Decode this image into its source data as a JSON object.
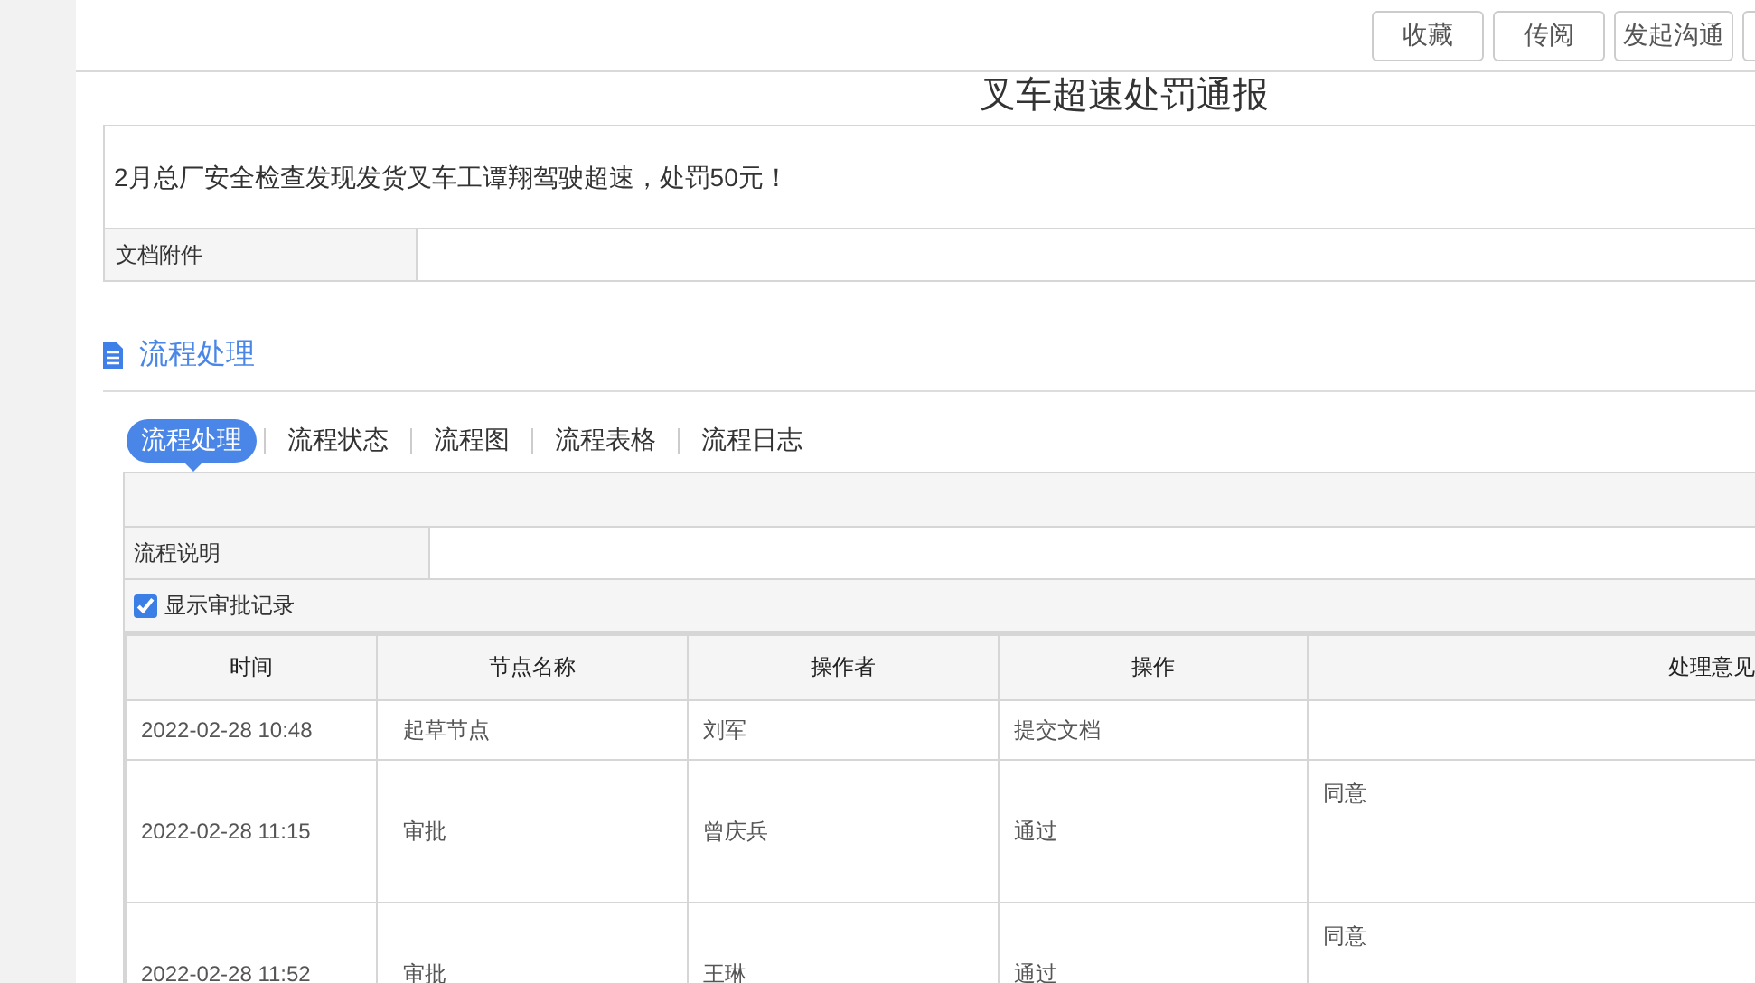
{
  "toolbar": {
    "buttons": [
      "收藏",
      "传阅",
      "发起沟通"
    ]
  },
  "document": {
    "title": "叉车超速处罚通报",
    "body": "2月总厂安全检查发现发货叉车工谭翔驾驶超速，处罚50元！",
    "attachment_label": "文档附件"
  },
  "section": {
    "title": "流程处理"
  },
  "tabs": [
    {
      "label": "流程处理",
      "selected": true
    },
    {
      "label": "流程状态",
      "selected": false
    },
    {
      "label": "流程图",
      "selected": false
    },
    {
      "label": "流程表格",
      "selected": false
    },
    {
      "label": "流程日志",
      "selected": false
    }
  ],
  "flow": {
    "description_label": "流程说明",
    "show_records": {
      "label": "显示审批记录",
      "checked": true
    }
  },
  "table": {
    "columns": [
      "时间",
      "节点名称",
      "操作者",
      "操作",
      "处理意见"
    ],
    "rows": [
      {
        "time": "2022-02-28 10:48",
        "node": "起草节点",
        "operator": "刘军",
        "action": "提交文档",
        "opinion": ""
      },
      {
        "time": "2022-02-28 11:15",
        "node": "审批",
        "operator": "曾庆兵",
        "action": "通过",
        "opinion": "同意"
      },
      {
        "time": "2022-02-28 11:52",
        "node": "审批",
        "operator": "王琳",
        "action": "通过",
        "opinion": "同意"
      }
    ]
  }
}
